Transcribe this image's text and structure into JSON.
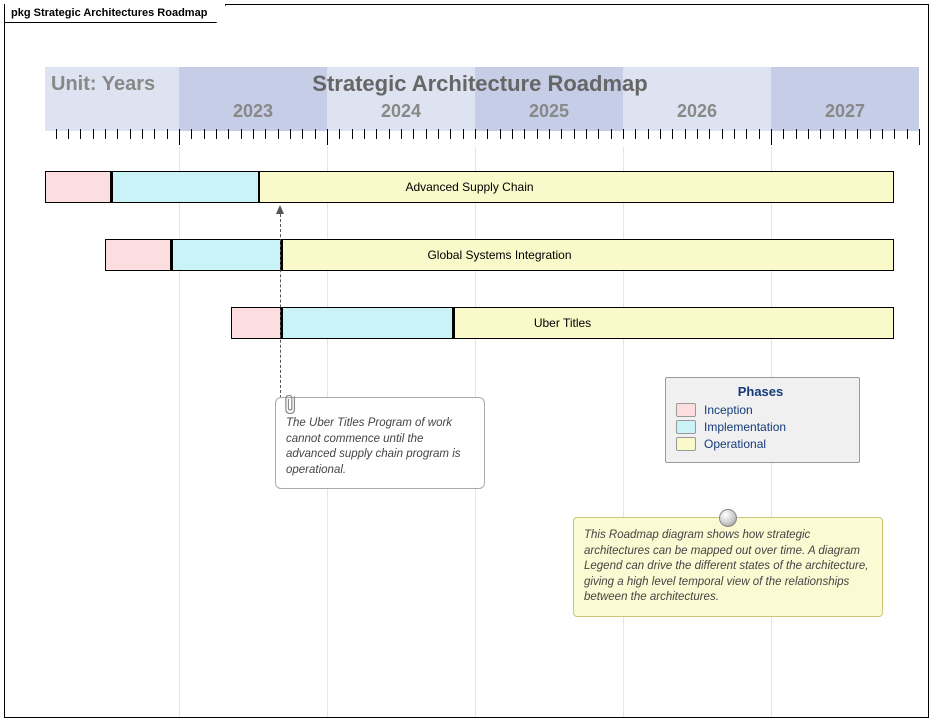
{
  "frame_title": "pkg Strategic Architectures Roadmap",
  "header": {
    "unit_label": "Unit: Years",
    "title": "Strategic Architecture Roadmap",
    "years": [
      "2023",
      "2024",
      "2025",
      "2026",
      "2027"
    ]
  },
  "bars": [
    {
      "label": "Advanced Supply Chain"
    },
    {
      "label": "Global Systems Integration"
    },
    {
      "label": "Uber Titles"
    }
  ],
  "note": {
    "text": "The Uber Titles Program of work cannot commence until the advanced supply chain program is operational."
  },
  "legend": {
    "title": "Phases",
    "items": [
      {
        "label": "Inception"
      },
      {
        "label": "Implementation"
      },
      {
        "label": "Operational"
      }
    ]
  },
  "yellow_note": {
    "text": "This Roadmap diagram shows how strategic architectures can be mapped out over time. A diagram Legend can drive the different states of the architecture, giving a high level temporal view of the relationships between the architectures."
  },
  "chart_data": {
    "type": "bar",
    "title": "Strategic Architecture Roadmap",
    "xlabel": "Years",
    "xlim": [
      2022.1,
      2028.0
    ],
    "series": [
      {
        "name": "Advanced Supply Chain",
        "phases": [
          {
            "phase": "Inception",
            "start": 2022.1,
            "end": 2022.55
          },
          {
            "phase": "Implementation",
            "start": 2022.55,
            "end": 2023.55
          },
          {
            "phase": "Operational",
            "start": 2023.55,
            "end": 2027.85
          }
        ]
      },
      {
        "name": "Global Systems Integration",
        "phases": [
          {
            "phase": "Inception",
            "start": 2022.5,
            "end": 2022.95
          },
          {
            "phase": "Implementation",
            "start": 2022.95,
            "end": 2023.7
          },
          {
            "phase": "Operational",
            "start": 2023.7,
            "end": 2027.85
          }
        ]
      },
      {
        "name": "Uber Titles",
        "phases": [
          {
            "phase": "Inception",
            "start": 2023.35,
            "end": 2023.7
          },
          {
            "phase": "Implementation",
            "start": 2023.7,
            "end": 2024.85
          },
          {
            "phase": "Operational",
            "start": 2024.85,
            "end": 2027.85
          }
        ]
      }
    ],
    "dependency": {
      "from": "Advanced Supply Chain (end Implementation)",
      "to": "Uber Titles (start Inception)",
      "at_year": 2023.55
    }
  }
}
